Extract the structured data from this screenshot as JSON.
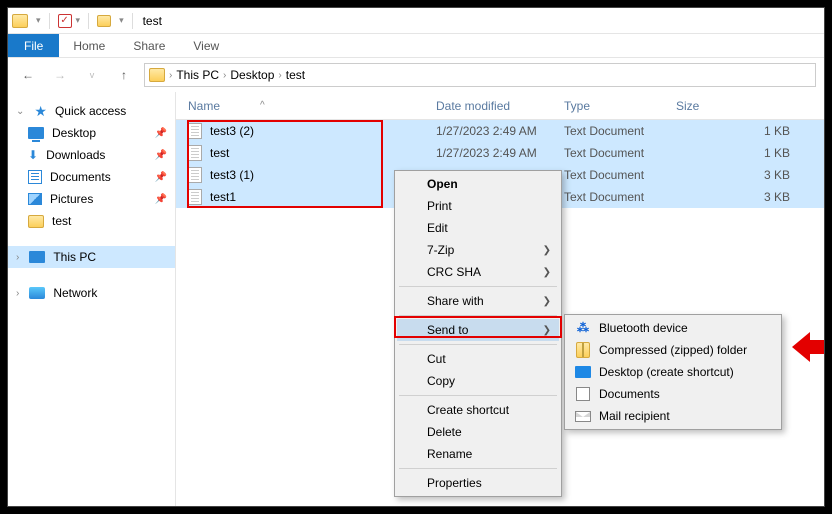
{
  "titlebar": {
    "title": "test"
  },
  "ribbon": {
    "file": "File",
    "home": "Home",
    "share": "Share",
    "view": "View"
  },
  "breadcrumb": {
    "pc": "This PC",
    "desktop": "Desktop",
    "folder": "test"
  },
  "sidebar": {
    "quick": "Quick access",
    "desktop": "Desktop",
    "downloads": "Downloads",
    "documents": "Documents",
    "pictures": "Pictures",
    "test": "test",
    "thispc": "This PC",
    "network": "Network"
  },
  "columns": {
    "name": "Name",
    "date": "Date modified",
    "type": "Type",
    "size": "Size"
  },
  "files": [
    {
      "name": "test3 (2)",
      "date": "1/27/2023 2:49 AM",
      "type": "Text Document",
      "size": "1 KB"
    },
    {
      "name": "test",
      "date": "1/27/2023 2:49 AM",
      "type": "Text Document",
      "size": "1 KB"
    },
    {
      "name": "test3 (1)",
      "date": "",
      "type": "Text Document",
      "size": "3 KB"
    },
    {
      "name": "test1",
      "date": "",
      "type": "Text Document",
      "size": "3 KB"
    }
  ],
  "ctx": {
    "open": "Open",
    "print": "Print",
    "edit": "Edit",
    "sevenzip": "7-Zip",
    "crc": "CRC SHA",
    "share": "Share with",
    "sendto": "Send to",
    "cut": "Cut",
    "copy": "Copy",
    "shortcut": "Create shortcut",
    "delete": "Delete",
    "rename": "Rename",
    "props": "Properties"
  },
  "sendto": {
    "bluetooth": "Bluetooth device",
    "zipped": "Compressed (zipped) folder",
    "desksc": "Desktop (create shortcut)",
    "docs": "Documents",
    "mail": "Mail recipient"
  }
}
